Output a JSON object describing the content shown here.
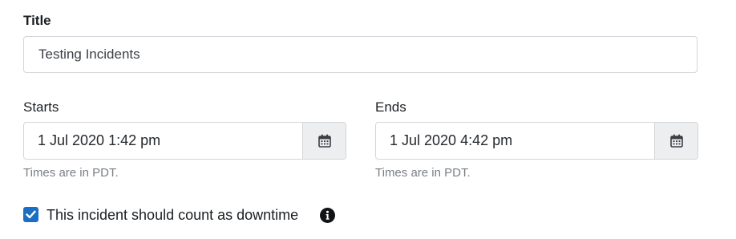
{
  "title_field": {
    "label": "Title",
    "value": "Testing Incidents"
  },
  "starts_field": {
    "label": "Starts",
    "value": "1 Jul 2020 1:42 pm",
    "hint": "Times are in PDT."
  },
  "ends_field": {
    "label": "Ends",
    "value": "1 Jul 2020 4:42 pm",
    "hint": "Times are in PDT."
  },
  "downtime": {
    "label": "This incident should count as downtime",
    "checked": true
  },
  "icons": {
    "calendar": "calendar-icon",
    "info": "info-icon",
    "checkmark": "checkmark-icon"
  },
  "colors": {
    "checkbox_accent": "#1a6fc4",
    "calendar_button_bg": "#eceef0",
    "input_border": "#d3d6da",
    "hint_text": "#7a7f85"
  }
}
